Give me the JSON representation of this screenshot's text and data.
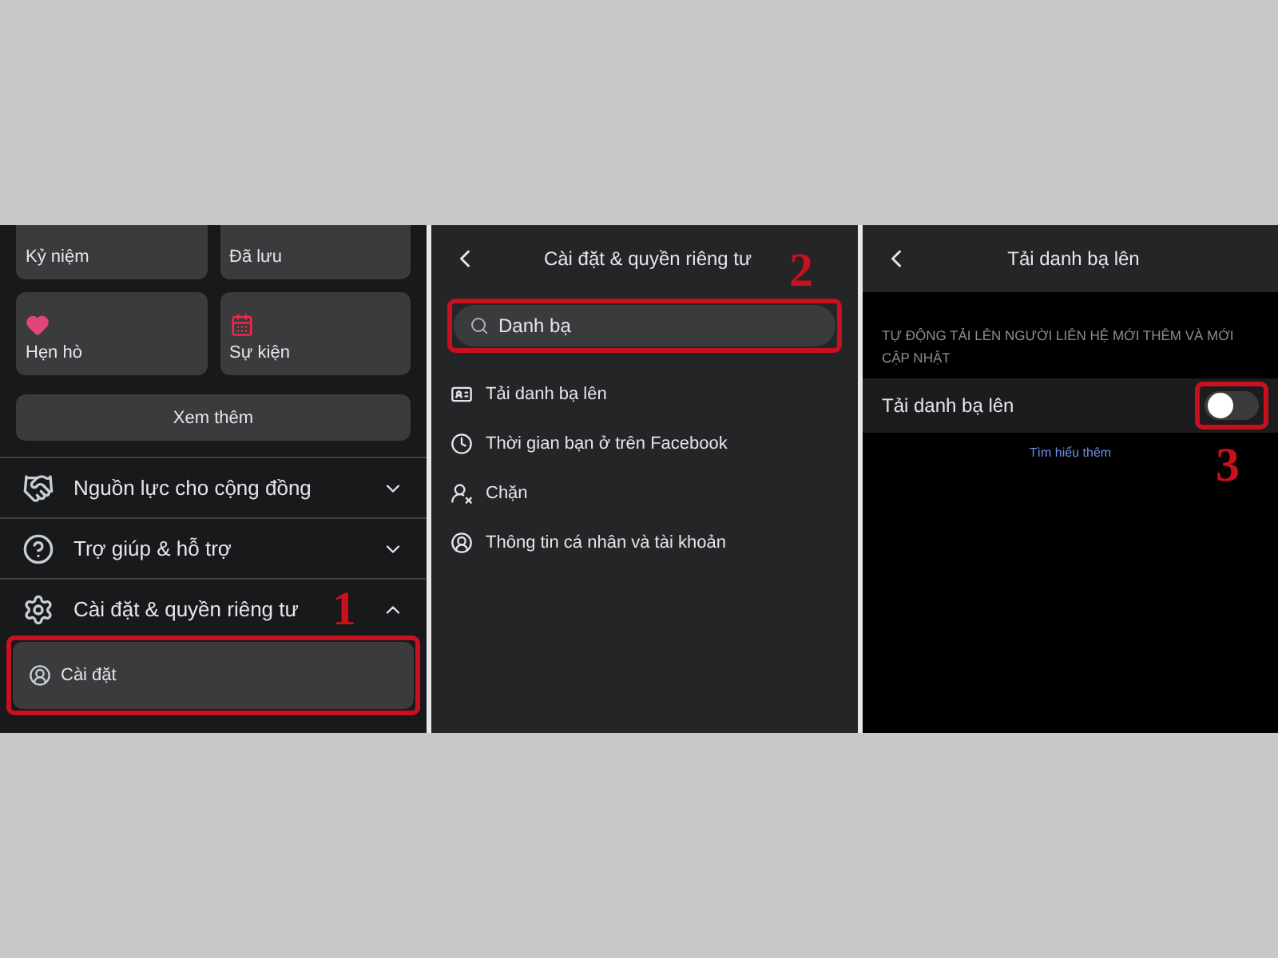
{
  "left_panel": {
    "shortcuts": [
      {
        "label": "Kỷ niệm",
        "kind": "plain"
      },
      {
        "label": "Đã lưu",
        "kind": "plain"
      },
      {
        "label": "Hẹn hò",
        "kind": "heart"
      },
      {
        "label": "Sự kiện",
        "kind": "calendar"
      }
    ],
    "see_more": "Xem thêm",
    "sections": [
      {
        "label": "Nguồn lực cho cộng đồng",
        "kind": "handshake",
        "expanded": false
      },
      {
        "label": "Trợ giúp & hỗ trợ",
        "kind": "help",
        "expanded": false
      },
      {
        "label": "Cài đặt & quyền riêng tư",
        "kind": "settings",
        "expanded": true,
        "step": "1",
        "children": [
          {
            "label": "Cài đặt",
            "highlighted": true
          }
        ]
      }
    ]
  },
  "middle_panel": {
    "title": "Cài đặt & quyền riêng tư",
    "step": "2",
    "search": {
      "value": "Danh bạ",
      "highlighted": true
    },
    "results": [
      {
        "label": "Tải danh bạ lên",
        "kind": "contact-card"
      },
      {
        "label": "Thời gian bạn ở trên Facebook",
        "kind": "clock"
      },
      {
        "label": "Chặn",
        "kind": "block-user"
      },
      {
        "label": "Thông tin cá nhân và tài khoản",
        "kind": "profile"
      }
    ]
  },
  "right_panel": {
    "title": "Tải danh bạ lên",
    "section_label": "TỰ ĐỘNG TẢI LÊN NGƯỜI LIÊN HỆ MỚI THÊM VÀ MỚI CẬP NHẬT",
    "setting": {
      "label": "Tải danh bạ lên",
      "on": false,
      "highlighted": true
    },
    "step": "3",
    "link": "Tìm hiểu thêm"
  }
}
